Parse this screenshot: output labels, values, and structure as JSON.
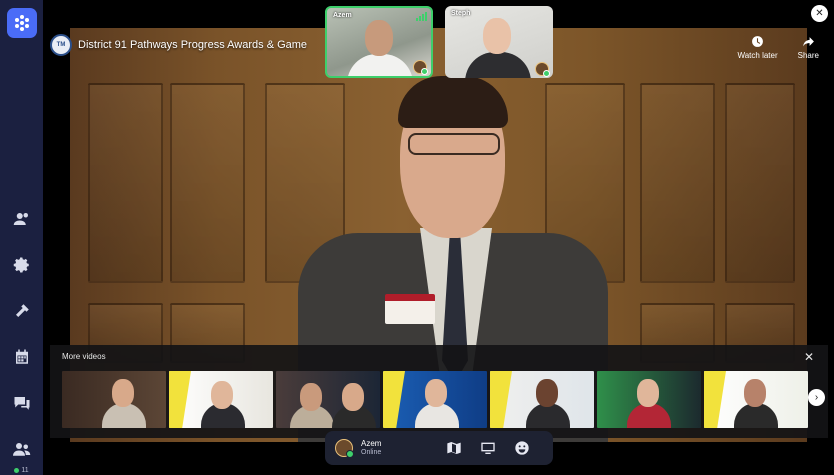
{
  "video": {
    "title": "District 91 Pathways Progress Awards & Game",
    "actions": [
      {
        "label": "Watch later",
        "icon": "clock-icon"
      },
      {
        "label": "Share",
        "icon": "share-icon"
      }
    ]
  },
  "participants": [
    {
      "name": "Azem",
      "speaking": true
    },
    {
      "name": "Steph",
      "speaking": false
    }
  ],
  "more_videos": {
    "title": "More videos",
    "count": 7
  },
  "controls": {
    "user_name": "Azem",
    "user_status": "Online"
  },
  "sidebar": {
    "users_online": "11"
  },
  "colors": {
    "accent": "#4a6cf7",
    "sidebar_bg": "#1b2040",
    "online": "#3ecf6b"
  }
}
